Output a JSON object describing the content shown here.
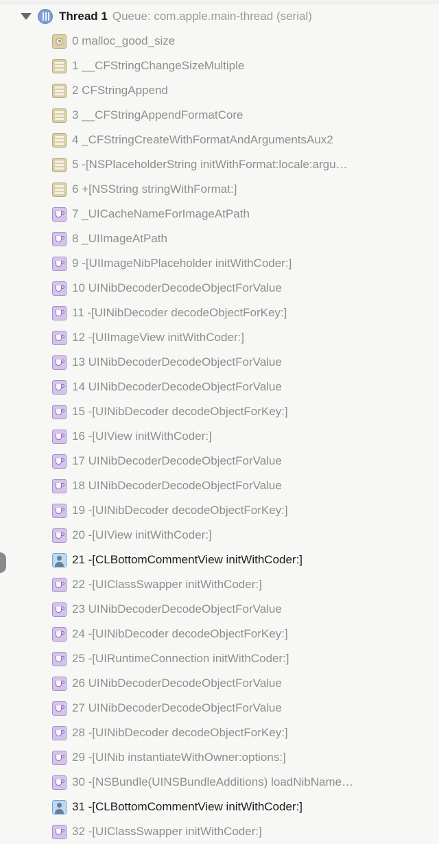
{
  "thread": {
    "disclosure_state": "expanded",
    "icon": "thread-icon",
    "name": "Thread 1",
    "queue": "Queue: com.apple.main-thread (serial)"
  },
  "colors": {
    "background": "#f7f7f5",
    "system_frame_text": "#8e8e8e",
    "user_frame_text": "#1b1b1b",
    "framework_icon": "#d9cfa8",
    "system_icon": "#d4c4ea",
    "user_icon": "#bcd8f2",
    "thread_icon": "#7b9fd4"
  },
  "left_handle": {
    "icon": "panel-expand-handle-icon"
  },
  "stack_frames": [
    {
      "index": "0",
      "label": "0 malloc_good_size",
      "icon": "gear-icon",
      "kind": "framework",
      "truncated": false
    },
    {
      "index": "1",
      "label": "1 __CFStringChangeSizeMultiple",
      "icon": "list-icon",
      "kind": "framework",
      "truncated": false
    },
    {
      "index": "2",
      "label": "2 CFStringAppend",
      "icon": "list-icon",
      "kind": "framework",
      "truncated": false
    },
    {
      "index": "3",
      "label": "3 __CFStringAppendFormatCore",
      "icon": "list-icon",
      "kind": "framework",
      "truncated": false
    },
    {
      "index": "4",
      "label": "4 _CFStringCreateWithFormatAndArgumentsAux2",
      "icon": "list-icon",
      "kind": "framework",
      "truncated": false
    },
    {
      "index": "5",
      "label": "5 -[NSPlaceholderString initWithFormat:locale:argu…",
      "icon": "list-icon",
      "kind": "framework",
      "truncated": true
    },
    {
      "index": "6",
      "label": "6 +[NSString stringWithFormat:]",
      "icon": "list-icon",
      "kind": "framework",
      "truncated": false
    },
    {
      "index": "7",
      "label": "7 _UICacheNameForImageAtPath",
      "icon": "cup-icon",
      "kind": "system",
      "truncated": false
    },
    {
      "index": "8",
      "label": "8 _UIImageAtPath",
      "icon": "cup-icon",
      "kind": "system",
      "truncated": false
    },
    {
      "index": "9",
      "label": "9 -[UIImageNibPlaceholder initWithCoder:]",
      "icon": "cup-icon",
      "kind": "system",
      "truncated": false
    },
    {
      "index": "10",
      "label": "10 UINibDecoderDecodeObjectForValue",
      "icon": "cup-icon",
      "kind": "system",
      "truncated": false
    },
    {
      "index": "11",
      "label": "11 -[UINibDecoder decodeObjectForKey:]",
      "icon": "cup-icon",
      "kind": "system",
      "truncated": false
    },
    {
      "index": "12",
      "label": "12 -[UIImageView initWithCoder:]",
      "icon": "cup-icon",
      "kind": "system",
      "truncated": false
    },
    {
      "index": "13",
      "label": "13 UINibDecoderDecodeObjectForValue",
      "icon": "cup-icon",
      "kind": "system",
      "truncated": false
    },
    {
      "index": "14",
      "label": "14 UINibDecoderDecodeObjectForValue",
      "icon": "cup-icon",
      "kind": "system",
      "truncated": false
    },
    {
      "index": "15",
      "label": "15 -[UINibDecoder decodeObjectForKey:]",
      "icon": "cup-icon",
      "kind": "system",
      "truncated": false
    },
    {
      "index": "16",
      "label": "16 -[UIView initWithCoder:]",
      "icon": "cup-icon",
      "kind": "system",
      "truncated": false
    },
    {
      "index": "17",
      "label": "17 UINibDecoderDecodeObjectForValue",
      "icon": "cup-icon",
      "kind": "system",
      "truncated": false
    },
    {
      "index": "18",
      "label": "18 UINibDecoderDecodeObjectForValue",
      "icon": "cup-icon",
      "kind": "system",
      "truncated": false
    },
    {
      "index": "19",
      "label": "19 -[UINibDecoder decodeObjectForKey:]",
      "icon": "cup-icon",
      "kind": "system",
      "truncated": false
    },
    {
      "index": "20",
      "label": "20 -[UIView initWithCoder:]",
      "icon": "cup-icon",
      "kind": "system",
      "truncated": false
    },
    {
      "index": "21",
      "label": "21 -[CLBottomCommentView initWithCoder:]",
      "icon": "person-icon",
      "kind": "user",
      "truncated": false
    },
    {
      "index": "22",
      "label": "22 -[UIClassSwapper initWithCoder:]",
      "icon": "cup-icon",
      "kind": "system",
      "truncated": false
    },
    {
      "index": "23",
      "label": "23 UINibDecoderDecodeObjectForValue",
      "icon": "cup-icon",
      "kind": "system",
      "truncated": false
    },
    {
      "index": "24",
      "label": "24 -[UINibDecoder decodeObjectForKey:]",
      "icon": "cup-icon",
      "kind": "system",
      "truncated": false
    },
    {
      "index": "25",
      "label": "25 -[UIRuntimeConnection initWithCoder:]",
      "icon": "cup-icon",
      "kind": "system",
      "truncated": false
    },
    {
      "index": "26",
      "label": "26 UINibDecoderDecodeObjectForValue",
      "icon": "cup-icon",
      "kind": "system",
      "truncated": false
    },
    {
      "index": "27",
      "label": "27 UINibDecoderDecodeObjectForValue",
      "icon": "cup-icon",
      "kind": "system",
      "truncated": false
    },
    {
      "index": "28",
      "label": "28 -[UINibDecoder decodeObjectForKey:]",
      "icon": "cup-icon",
      "kind": "system",
      "truncated": false
    },
    {
      "index": "29",
      "label": "29 -[UINib instantiateWithOwner:options:]",
      "icon": "cup-icon",
      "kind": "system",
      "truncated": false
    },
    {
      "index": "30",
      "label": "30 -[NSBundle(UINSBundleAdditions) loadNibName…",
      "icon": "cup-icon",
      "kind": "system",
      "truncated": true
    },
    {
      "index": "31",
      "label": "31 -[CLBottomCommentView initWithCoder:]",
      "icon": "person-icon",
      "kind": "user",
      "truncated": false
    },
    {
      "index": "32",
      "label": "32 -[UIClassSwapper initWithCoder:]",
      "icon": "cup-icon",
      "kind": "system",
      "truncated": false
    }
  ]
}
